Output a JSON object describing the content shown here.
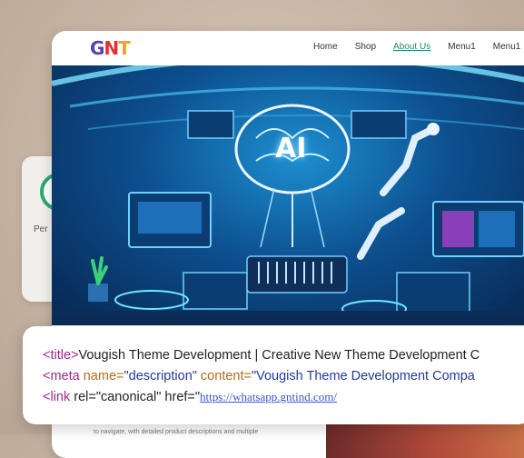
{
  "site": {
    "logo_text": "GNT",
    "nav": [
      "Home",
      "Shop",
      "About Us",
      "Menu1",
      "Menu1"
    ],
    "active_nav": "About Us",
    "hero_center_text": "AI",
    "footer_text": "to navigate, with detailed product descriptions and multiple"
  },
  "side_card": {
    "label": "Per"
  },
  "code": {
    "line1_tag_open": "<title>",
    "line1_text": "Vougish Theme Development | Creative New Theme Development C",
    "line2_tag": "<meta ",
    "line2_attr1": "name=",
    "line2_val1": "\"description\"",
    "line2_attr2": " content=",
    "line2_val2": "\"Vougish Theme Development Compa",
    "line3_tag": "<link ",
    "line3_rest": "rel=\"canonical\" href=\"",
    "line3_url": "https://whatsapp.gntind.com/"
  },
  "colors": {
    "accent_green": "#1e8a6e",
    "tag_purple": "#9b2a8a",
    "attr_orange": "#b06a1e"
  }
}
